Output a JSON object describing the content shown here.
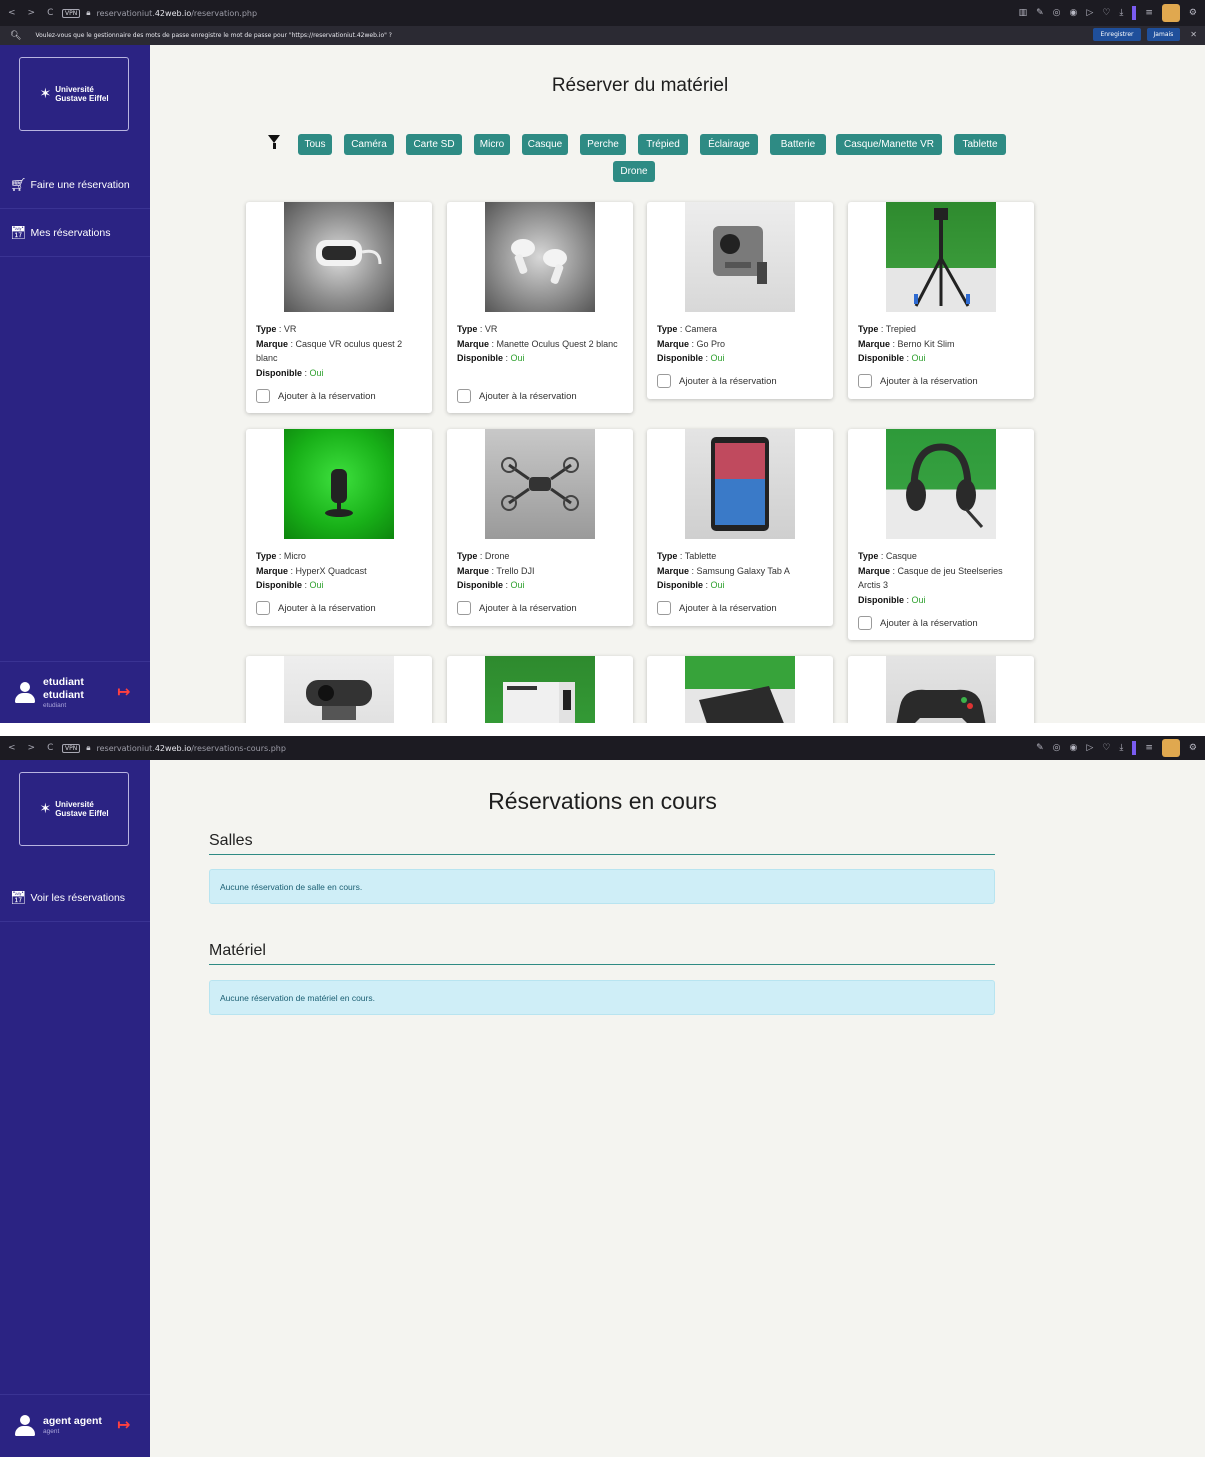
{
  "screen1": {
    "browser": {
      "nav": [
        "<",
        ">",
        "C"
      ],
      "vpn": "VPN",
      "url_host": "reservationiut.42web.io",
      "url_path": "/reservation.php"
    },
    "password_prompt": {
      "text": "Voulez-vous que le gestionnaire des mots de passe enregistre le mot de passe pour \"https://reservationiut.42web.io\" ?",
      "save_label": "Enregistrer",
      "never_label": "Jamais"
    },
    "sidebar": {
      "logo_line1": "Université",
      "logo_line2": "Gustave Eiffel",
      "items": [
        {
          "label": "Faire une réservation"
        },
        {
          "label": "Mes réservations"
        }
      ],
      "user_name1": "etudiant",
      "user_name2": "etudiant",
      "user_role": "etudiant"
    },
    "title": "Réserver du matériel",
    "filters": [
      "Tous",
      "Caméra",
      "Carte SD",
      "Micro",
      "Casque",
      "Perche",
      "Trépied",
      "Éclairage",
      "Batterie",
      "Casque/Manette VR",
      "Tablette",
      "Drone"
    ],
    "labels": {
      "type": "Type",
      "brand": "Marque",
      "available": "Disponible",
      "add": "Ajouter à la réservation"
    },
    "cards": [
      {
        "type": "VR",
        "brand": "Casque VR oculus quest 2 blanc",
        "available": "Oui"
      },
      {
        "type": "VR",
        "brand": "Manette Oculus Quest 2 blanc",
        "available": "Oui"
      },
      {
        "type": "Camera",
        "brand": "Go Pro",
        "available": "Oui"
      },
      {
        "type": "Trepied",
        "brand": "Berno Kit Slim",
        "available": "Oui"
      },
      {
        "type": "Micro",
        "brand": "HyperX Quadcast",
        "available": "Oui"
      },
      {
        "type": "Drone",
        "brand": "Trello DJI",
        "available": "Oui"
      },
      {
        "type": "Tablette",
        "brand": "Samsung Galaxy Tab A",
        "available": "Oui"
      },
      {
        "type": "Casque",
        "brand": "Casque de jeu Steelseries Arctis 3",
        "available": "Oui"
      }
    ]
  },
  "screen2": {
    "browser": {
      "url_host": "reservationiut.42web.io",
      "url_path": "/reservations-cours.php"
    },
    "sidebar": {
      "logo_line1": "Université",
      "logo_line2": "Gustave Eiffel",
      "item_label": "Voir les réservations",
      "user_name": "agent agent",
      "user_role": "agent"
    },
    "title": "Réservations en cours",
    "sections": [
      {
        "heading": "Salles",
        "message": "Aucune réservation de salle en cours."
      },
      {
        "heading": "Matériel",
        "message": "Aucune réservation de matériel en cours."
      }
    ]
  },
  "colors": {
    "sidebar": "#2b2383",
    "accent": "#2e8b84",
    "available": "#2ea02e",
    "logout": "#ff4040",
    "alert_bg": "#cfeef7"
  },
  "icons": [
    "filter-icon",
    "cart-icon",
    "calendar-icon",
    "user-icon",
    "logout-icon",
    "lock-icon",
    "key-icon"
  ]
}
